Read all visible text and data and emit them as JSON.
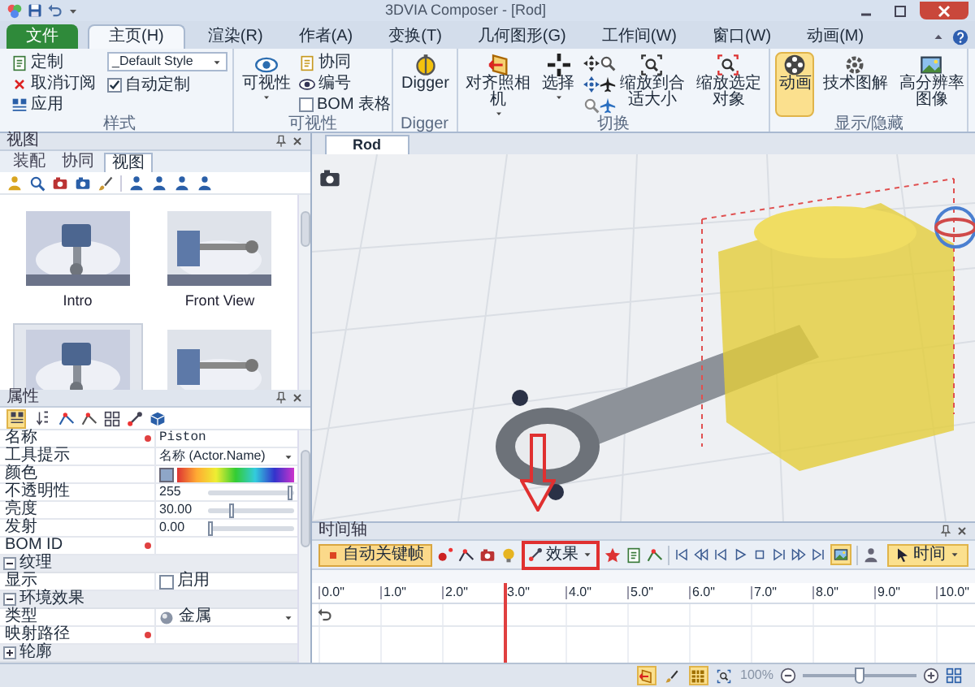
{
  "window": {
    "title": "3DVIA Composer - [Rod]"
  },
  "ribbon_tabs": [
    {
      "label": "文件",
      "kind": "file",
      "selected": false
    },
    {
      "label": "主页(H)",
      "kind": "tab",
      "selected": true
    },
    {
      "label": "渲染(R)",
      "kind": "tab",
      "selected": false
    },
    {
      "label": "作者(A)",
      "kind": "tab",
      "selected": false
    },
    {
      "label": "变换(T)",
      "kind": "tab",
      "selected": false
    },
    {
      "label": "几何图形(G)",
      "kind": "tab",
      "selected": false
    },
    {
      "label": "工作间(W)",
      "kind": "tab",
      "selected": false
    },
    {
      "label": "窗口(W)",
      "kind": "tab",
      "selected": false
    },
    {
      "label": "动画(M)",
      "kind": "tab",
      "selected": false
    }
  ],
  "ribbon_groups": [
    {
      "kind": "style",
      "title": "样式",
      "commands": [
        "定制",
        "取消订阅",
        "应用"
      ],
      "style_dropdown": "_Default Style",
      "auto_custom": {
        "label": "自动定制",
        "checked": true
      }
    },
    {
      "kind": "visibility",
      "title": "可视性",
      "big_button": "可视性",
      "commands": [
        "协同",
        "编号"
      ],
      "bom_table": {
        "label": "BOM 表格",
        "checked": false
      }
    },
    {
      "kind": "buttons",
      "title": "Digger",
      "buttons": [
        {
          "kind": "big",
          "label": "Digger",
          "selected": false,
          "dropdown": false
        }
      ]
    },
    {
      "kind": "buttons",
      "title": "切换",
      "buttons": [
        {
          "kind": "big",
          "label": "对齐照相机",
          "selected": false,
          "dropdown": true
        },
        {
          "kind": "big",
          "label": "选择",
          "selected": false,
          "dropdown": true
        },
        {
          "kind": "tools"
        },
        {
          "kind": "big",
          "label": "缩放到合适大小",
          "selected": false,
          "dropdown": false
        },
        {
          "kind": "big",
          "label": "缩放选定对象",
          "selected": false,
          "dropdown": false
        }
      ]
    },
    {
      "kind": "buttons",
      "title": "显示/隐藏",
      "buttons": [
        {
          "kind": "big",
          "label": "动画",
          "selected": true,
          "dropdown": false
        },
        {
          "kind": "big",
          "label": "技术图解",
          "selected": false,
          "dropdown": false
        },
        {
          "kind": "big",
          "label": "高分辨率图像",
          "selected": false,
          "dropdown": false
        }
      ]
    }
  ],
  "views_panel": {
    "title": "视图",
    "tabs": [
      {
        "label": "装配",
        "selected": false
      },
      {
        "label": "协同",
        "selected": false
      },
      {
        "label": "视图",
        "selected": true
      }
    ],
    "thumbnails": [
      {
        "label": "Intro",
        "selected": false
      },
      {
        "label": "Front View",
        "selected": false
      },
      {
        "selected": true
      },
      {
        "selected": false
      }
    ]
  },
  "properties_panel": {
    "title": "属性",
    "view_modes": [
      {
        "selected": true
      },
      {
        "selected": false
      }
    ],
    "rows": [
      {
        "kind": "text",
        "name": "名称",
        "value": "Piston",
        "required": true
      },
      {
        "kind": "dropdown",
        "name": "工具提示",
        "value": "名称 (Actor.Name)",
        "required": false
      },
      {
        "kind": "color",
        "name": "颜色",
        "required": false
      },
      {
        "kind": "slider",
        "name": "不透明性",
        "value": "255",
        "level": 1,
        "required": false
      },
      {
        "kind": "slider",
        "name": "亮度",
        "value": "30.00",
        "level": 0.27,
        "required": false
      },
      {
        "kind": "slider",
        "name": "发射",
        "value": "0.00",
        "level": 0,
        "required": false
      },
      {
        "kind": "text",
        "name": "BOM ID",
        "required": true
      },
      {
        "kind": "section",
        "name": "纹理",
        "expanded": true
      },
      {
        "kind": "checkbox",
        "name": "显示",
        "label": "启用",
        "checked": false,
        "required": false
      },
      {
        "kind": "section",
        "name": "环境效果",
        "expanded": true
      },
      {
        "kind": "material",
        "name": "类型",
        "value": "金属",
        "required": false
      },
      {
        "kind": "text",
        "name": "映射路径",
        "required": true
      },
      {
        "kind": "section",
        "name": "轮廓",
        "expanded": false
      }
    ]
  },
  "viewport": {
    "tab": "Rod"
  },
  "timeline": {
    "title": "时间轴",
    "auto_key_button": "自动关键帧",
    "effects_button": "效果",
    "display_toggle": {
      "selected": true
    },
    "time_button": {
      "label": "时间",
      "selected": true
    },
    "ticks": [
      "0.0\"",
      "1.0\"",
      "2.0\"",
      "3.0\"",
      "4.0\"",
      "5.0\"",
      "6.0\"",
      "7.0\"",
      "8.0\"",
      "9.0\"",
      "10.0\""
    ],
    "playhead": {
      "level": 0.3
    }
  },
  "status_bar": {
    "toggles": [
      {
        "selected": true
      },
      {
        "selected": false
      },
      {
        "selected": true
      },
      {
        "selected": false
      }
    ],
    "zoom": "100%",
    "zoom_slider": {
      "level": 0.5
    }
  }
}
